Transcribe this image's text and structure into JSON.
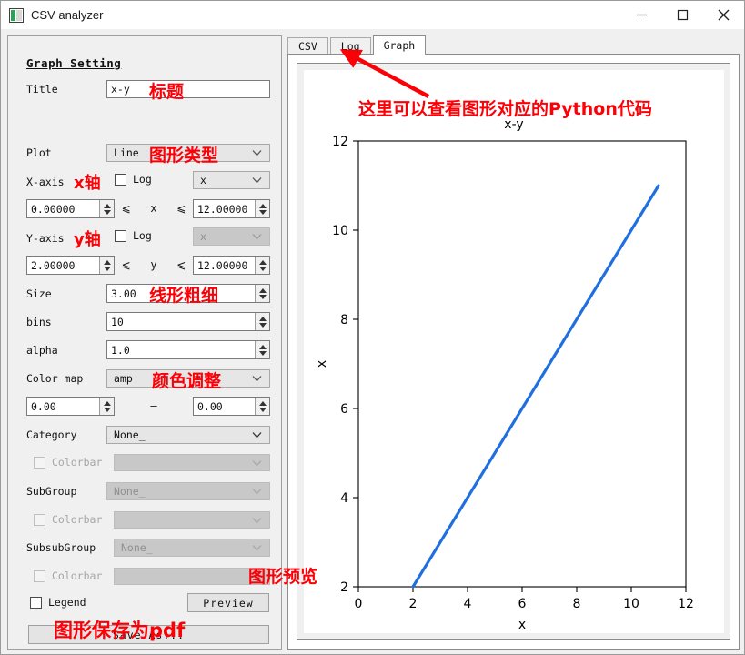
{
  "window": {
    "title": "CSV analyzer",
    "icon": "app-icon",
    "minimize": "–",
    "maximize": "▢",
    "close": "✕"
  },
  "settings": {
    "heading": "Graph Setting",
    "title_label": "Title",
    "title_value": "x-y",
    "plot_label": "Plot",
    "plot_value": "Line",
    "xaxis_label": "X-axis",
    "xaxis_log_label": "Log",
    "xaxis_column": "x",
    "xaxis_min": "0.00000",
    "xaxis_cmp_left": "⩽",
    "xaxis_var": "x",
    "xaxis_cmp_right": "⩽",
    "xaxis_max": "12.00000",
    "yaxis_label": "Y-axis",
    "yaxis_log_label": "Log",
    "yaxis_column": "x",
    "yaxis_min": "2.00000",
    "yaxis_cmp_left": "⩽",
    "yaxis_var": "y",
    "yaxis_cmp_right": "⩽",
    "yaxis_max": "12.00000",
    "size_label": "Size",
    "size_value": "3.00",
    "bins_label": "bins",
    "bins_value": "10",
    "alpha_label": "alpha",
    "alpha_value": "1.0",
    "colormap_label": "Color map",
    "colormap_value": "amp",
    "cmap_min": "0.00",
    "cmap_dash": "–",
    "cmap_max": "0.00",
    "category_label": "Category",
    "category_value": "None_",
    "category_colorbar_label": "Colorbar",
    "category_colorbar_value": "",
    "subgroup_label": "SubGroup",
    "subgroup_value": "None_",
    "subgroup_colorbar_label": "Colorbar",
    "subgroup_colorbar_value": "",
    "subsubgroup_label": "SubsubGroup",
    "subsubgroup_value": "None_",
    "subsubgroup_colorbar_label": "Colorbar",
    "subsubgroup_colorbar_value": "",
    "legend_label": "Legend",
    "preview_label": "Preview",
    "save_label": "Save As..."
  },
  "tabs": [
    {
      "label": "CSV",
      "active": false
    },
    {
      "label": "Log",
      "active": false
    },
    {
      "label": "Graph",
      "active": true
    }
  ],
  "annotations": {
    "title_note": "标题",
    "plot_note": "图形类型",
    "xaxis_note": "x轴",
    "yaxis_note": "y轴",
    "size_note": "线形粗细",
    "colormap_note": "颜色调整",
    "preview_note": "图形预览",
    "save_note": "图形保存为pdf",
    "log_tab_note": "这里可以查看图形对应的Python代码",
    "arrow_color": "#fb0007"
  },
  "chart_data": {
    "type": "line",
    "title": "x-y",
    "xlabel": "x",
    "ylabel": "x",
    "xlim": [
      0,
      12
    ],
    "ylim": [
      2,
      12
    ],
    "xticks": [
      0,
      2,
      4,
      6,
      8,
      10,
      12
    ],
    "yticks": [
      2,
      4,
      6,
      8,
      10,
      12
    ],
    "grid": false,
    "legend": false,
    "series": [
      {
        "name": "x-y",
        "color": "#1f6fe0",
        "linewidth": 3.0,
        "x": [
          2,
          11
        ],
        "y": [
          2,
          11
        ]
      }
    ]
  },
  "colors": {
    "accent_red": "#fb0007",
    "line_blue": "#1f6fe0",
    "panel_bg": "#f0f0f0",
    "field_bg": "#ffffff",
    "combo_bg": "#e6e6e6",
    "disabled_bg": "#c8c8c8"
  }
}
